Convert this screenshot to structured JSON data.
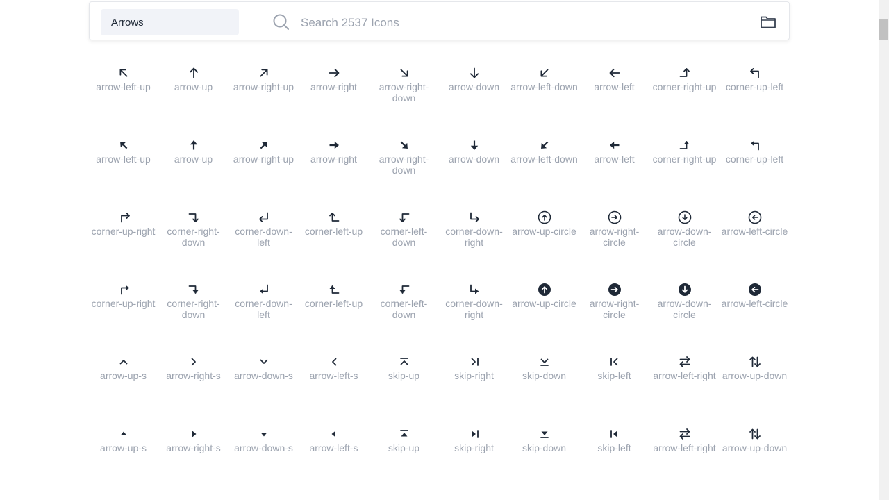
{
  "toolbar": {
    "category": "Arrows",
    "search_placeholder": "Search 2537 Icons",
    "search_icon": "search-icon",
    "folder_icon": "folder-icon"
  },
  "icons": [
    {
      "label": "arrow-left-up",
      "style": "outline"
    },
    {
      "label": "arrow-up",
      "style": "outline"
    },
    {
      "label": "arrow-right-up",
      "style": "outline"
    },
    {
      "label": "arrow-right",
      "style": "outline"
    },
    {
      "label": "arrow-right-down",
      "style": "outline"
    },
    {
      "label": "arrow-down",
      "style": "outline"
    },
    {
      "label": "arrow-left-down",
      "style": "outline"
    },
    {
      "label": "arrow-left",
      "style": "outline"
    },
    {
      "label": "corner-right-up",
      "style": "outline"
    },
    {
      "label": "corner-up-left",
      "style": "outline"
    },
    {
      "label": "arrow-left-up",
      "style": "solid"
    },
    {
      "label": "arrow-up",
      "style": "solid"
    },
    {
      "label": "arrow-right-up",
      "style": "solid"
    },
    {
      "label": "arrow-right",
      "style": "solid"
    },
    {
      "label": "arrow-right-down",
      "style": "solid"
    },
    {
      "label": "arrow-down",
      "style": "solid"
    },
    {
      "label": "arrow-left-down",
      "style": "solid"
    },
    {
      "label": "arrow-left",
      "style": "solid"
    },
    {
      "label": "corner-right-up",
      "style": "solid"
    },
    {
      "label": "corner-up-left",
      "style": "solid"
    },
    {
      "label": "corner-up-right",
      "style": "outline"
    },
    {
      "label": "corner-right-down",
      "style": "outline"
    },
    {
      "label": "corner-down-left",
      "style": "outline"
    },
    {
      "label": "corner-left-up",
      "style": "outline"
    },
    {
      "label": "corner-left-down",
      "style": "outline"
    },
    {
      "label": "corner-down-right",
      "style": "outline"
    },
    {
      "label": "arrow-up-circle",
      "style": "outline"
    },
    {
      "label": "arrow-right-circle",
      "style": "outline"
    },
    {
      "label": "arrow-down-circle",
      "style": "outline"
    },
    {
      "label": "arrow-left-circle",
      "style": "outline"
    },
    {
      "label": "corner-up-right",
      "style": "solid"
    },
    {
      "label": "corner-right-down",
      "style": "solid"
    },
    {
      "label": "corner-down-left",
      "style": "solid"
    },
    {
      "label": "corner-left-up",
      "style": "solid"
    },
    {
      "label": "corner-left-down",
      "style": "solid"
    },
    {
      "label": "corner-down-right",
      "style": "solid"
    },
    {
      "label": "arrow-up-circle",
      "style": "solid"
    },
    {
      "label": "arrow-right-circle",
      "style": "solid"
    },
    {
      "label": "arrow-down-circle",
      "style": "solid"
    },
    {
      "label": "arrow-left-circle",
      "style": "solid"
    },
    {
      "label": "arrow-up-s",
      "style": "outline"
    },
    {
      "label": "arrow-right-s",
      "style": "outline"
    },
    {
      "label": "arrow-down-s",
      "style": "outline"
    },
    {
      "label": "arrow-left-s",
      "style": "outline"
    },
    {
      "label": "skip-up",
      "style": "outline"
    },
    {
      "label": "skip-right",
      "style": "outline"
    },
    {
      "label": "skip-down",
      "style": "outline"
    },
    {
      "label": "skip-left",
      "style": "outline"
    },
    {
      "label": "arrow-left-right",
      "style": "outline"
    },
    {
      "label": "arrow-up-down",
      "style": "outline"
    },
    {
      "label": "arrow-up-s",
      "style": "solid"
    },
    {
      "label": "arrow-right-s",
      "style": "solid"
    },
    {
      "label": "arrow-down-s",
      "style": "solid"
    },
    {
      "label": "arrow-left-s",
      "style": "solid"
    },
    {
      "label": "skip-up",
      "style": "solid"
    },
    {
      "label": "skip-right",
      "style": "solid"
    },
    {
      "label": "skip-down",
      "style": "solid"
    },
    {
      "label": "skip-left",
      "style": "solid"
    },
    {
      "label": "arrow-left-right",
      "style": "solid"
    },
    {
      "label": "arrow-up-down",
      "style": "solid"
    }
  ],
  "colors": {
    "icon": "#1f2937",
    "label": "#9ca3af",
    "select_bg": "#f1f3f8"
  }
}
